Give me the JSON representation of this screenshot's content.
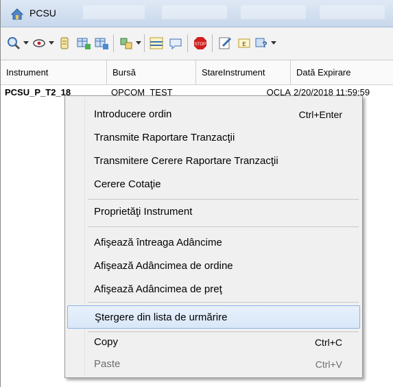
{
  "window": {
    "title": "PCSU"
  },
  "table": {
    "columns": [
      "Instrument",
      "Bursă",
      "StareInstrument",
      "Dată Expirare"
    ],
    "rows": [
      {
        "instrument": "PCSU_P_T2_18",
        "bursa": "OPCOM_TEST",
        "stare": "OCLA",
        "expirare": "2/20/2018 11:59:59"
      }
    ]
  },
  "context_menu": {
    "items": [
      {
        "label": "Introducere ordin",
        "shortcut": "Ctrl+Enter"
      },
      {
        "label": "Transmite Raportare Tranzacţii",
        "shortcut": ""
      },
      {
        "label": "Transmitere Cerere Raportare Tranzacţii",
        "shortcut": ""
      },
      {
        "label": "Cerere Cotaţie",
        "shortcut": ""
      },
      {
        "label": "Proprietăţi Instrument",
        "shortcut": ""
      },
      {
        "label": "Afişează întreaga Adâncime",
        "shortcut": ""
      },
      {
        "label": "Afişează Adâncimea de ordine",
        "shortcut": ""
      },
      {
        "label": "Afişează Adâncimea de preţ",
        "shortcut": ""
      },
      {
        "label": "Ştergere din lista de urmărire",
        "shortcut": ""
      },
      {
        "label": "Copy",
        "shortcut": "Ctrl+C"
      },
      {
        "label": "Paste",
        "shortcut": "Ctrl+V",
        "disabled": true
      }
    ]
  },
  "toolbar": {
    "icons": [
      "zoom-icon",
      "view-icon",
      "note-icon",
      "grid-add-icon",
      "grid-remove-icon",
      "link-icon",
      "chart-icon",
      "comment-icon",
      "stop-icon",
      "edit-icon",
      "window-icon",
      "help-icon"
    ]
  },
  "colors": {
    "highlight_border": "#8fb4e4",
    "titlebar": "#c7d7ec",
    "stop_red": "#d01f1f"
  }
}
